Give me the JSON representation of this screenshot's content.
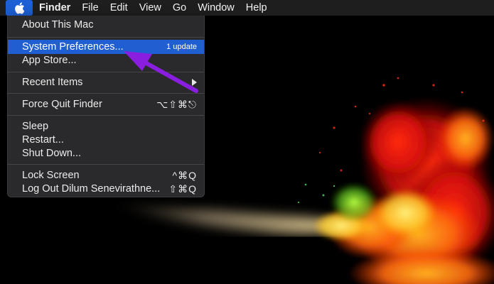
{
  "menubar": {
    "apple_icon": "apple-logo-icon",
    "app_name": "Finder",
    "items": [
      "File",
      "Edit",
      "View",
      "Go",
      "Window",
      "Help"
    ]
  },
  "apple_menu": {
    "about": "About This Mac",
    "system_prefs": "System Preferences...",
    "system_prefs_badge": "1 update",
    "app_store": "App Store...",
    "recent_items": "Recent Items",
    "force_quit": "Force Quit Finder",
    "force_quit_shortcut": "⌥⇧⌘⎋",
    "sleep": "Sleep",
    "restart": "Restart...",
    "shut_down": "Shut Down...",
    "lock_screen": "Lock Screen",
    "lock_screen_shortcut": "^⌘Q",
    "log_out": "Log Out Dilum Senevirathne...",
    "log_out_shortcut": "⇧⌘Q"
  },
  "colors": {
    "highlight": "#1f5fd1",
    "annotation_arrow": "#8a1ee0",
    "menu_background": "#2a2a2c"
  }
}
